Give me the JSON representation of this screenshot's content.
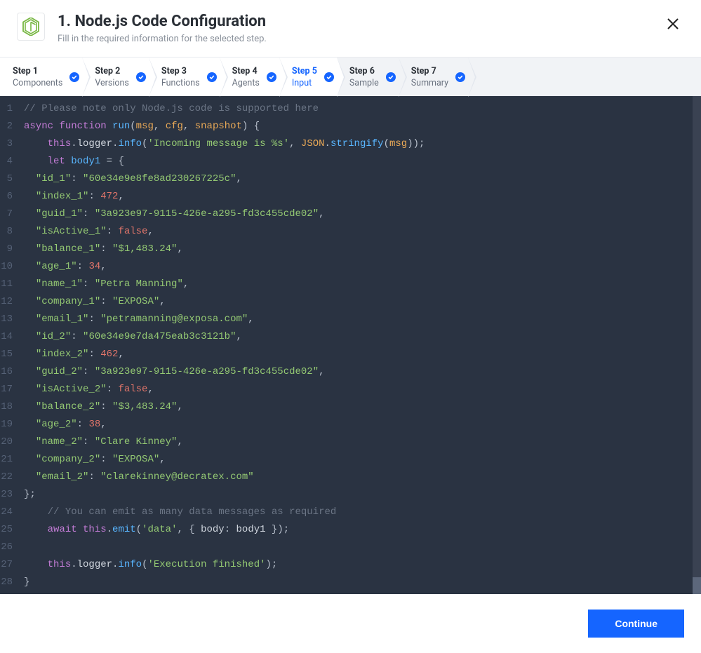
{
  "header": {
    "title": "1. Node.js Code Configuration",
    "subtitle": "Fill in the required information for the selected step."
  },
  "steps": [
    {
      "label": "Step 1",
      "sub": "Components",
      "active": false,
      "done": true
    },
    {
      "label": "Step 2",
      "sub": "Versions",
      "active": false,
      "done": true
    },
    {
      "label": "Step 3",
      "sub": "Functions",
      "active": false,
      "done": true
    },
    {
      "label": "Step 4",
      "sub": "Agents",
      "active": false,
      "done": true
    },
    {
      "label": "Step 5",
      "sub": "Input",
      "active": true,
      "done": true
    },
    {
      "label": "Step 6",
      "sub": "Sample",
      "active": false,
      "done": true,
      "inactive": true
    },
    {
      "label": "Step 7",
      "sub": "Summary",
      "active": false,
      "done": true,
      "inactive": true
    }
  ],
  "footer": {
    "continue_label": "Continue"
  },
  "code": {
    "lines": [
      {
        "t": "comment",
        "text": "// Please note only Node.js code is supported here"
      },
      {
        "t": "sig"
      },
      {
        "t": "log_incoming"
      },
      {
        "t": "let_body"
      },
      {
        "t": "kv_str",
        "k": "id_1",
        "v": "60e34e9e8fe8ad230267225c"
      },
      {
        "t": "kv_num",
        "k": "index_1",
        "v": 472
      },
      {
        "t": "kv_str",
        "k": "guid_1",
        "v": "3a923e97-9115-426e-a295-fd3c455cde02"
      },
      {
        "t": "kv_bool",
        "k": "isActive_1",
        "v": false
      },
      {
        "t": "kv_str",
        "k": "balance_1",
        "v": "$1,483.24"
      },
      {
        "t": "kv_num",
        "k": "age_1",
        "v": 34
      },
      {
        "t": "kv_str",
        "k": "name_1",
        "v": "Petra Manning"
      },
      {
        "t": "kv_str",
        "k": "company_1",
        "v": "EXPOSA"
      },
      {
        "t": "kv_str",
        "k": "email_1",
        "v": "petramanning@exposa.com"
      },
      {
        "t": "kv_str",
        "k": "id_2",
        "v": "60e34e9e7da475eab3c3121b"
      },
      {
        "t": "kv_num",
        "k": "index_2",
        "v": 462
      },
      {
        "t": "kv_str",
        "k": "guid_2",
        "v": "3a923e97-9115-426e-a295-fd3c455cde02"
      },
      {
        "t": "kv_bool",
        "k": "isActive_2",
        "v": false
      },
      {
        "t": "kv_str",
        "k": "balance_2",
        "v": "$3,483.24"
      },
      {
        "t": "kv_num",
        "k": "age_2",
        "v": 38
      },
      {
        "t": "kv_str",
        "k": "name_2",
        "v": "Clare Kinney"
      },
      {
        "t": "kv_str",
        "k": "company_2",
        "v": "EXPOSA"
      },
      {
        "t": "kv_str_last",
        "k": "email_2",
        "v": "clarekinney@decratex.com"
      },
      {
        "t": "close_obj"
      },
      {
        "t": "comment_ind",
        "text": "// You can emit as many data messages as required"
      },
      {
        "t": "emit"
      },
      {
        "t": "blank"
      },
      {
        "t": "log_done"
      },
      {
        "t": "close_fn"
      }
    ]
  }
}
